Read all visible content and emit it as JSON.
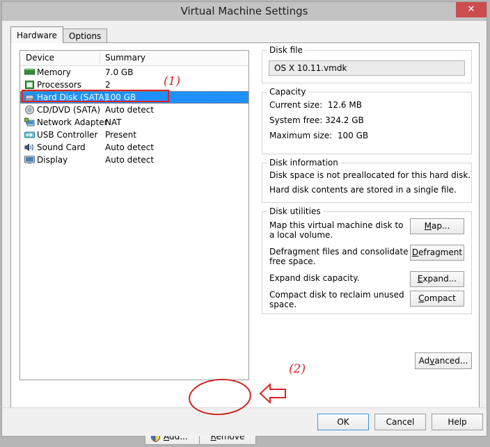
{
  "window": {
    "title": "Virtual Machine Settings",
    "close_label": "✕"
  },
  "tabs": [
    {
      "label": "Hardware",
      "active": true
    },
    {
      "label": "Options",
      "active": false
    }
  ],
  "device_list": {
    "columns": [
      "Device",
      "Summary"
    ],
    "rows": [
      {
        "icon": "memory-icon",
        "device": "Memory",
        "summary": "7.0 GB",
        "selected": false
      },
      {
        "icon": "processors-icon",
        "device": "Processors",
        "summary": "2",
        "selected": false
      },
      {
        "icon": "hard-disk-icon",
        "device": "Hard Disk (SATA)",
        "summary": "100 GB",
        "selected": true
      },
      {
        "icon": "cd-dvd-icon",
        "device": "CD/DVD (SATA)",
        "summary": "Auto detect",
        "selected": false
      },
      {
        "icon": "network-adapter-icon",
        "device": "Network Adapter",
        "summary": "NAT",
        "selected": false
      },
      {
        "icon": "usb-controller-icon",
        "device": "USB Controller",
        "summary": "Present",
        "selected": false
      },
      {
        "icon": "sound-card-icon",
        "device": "Sound Card",
        "summary": "Auto detect",
        "selected": false
      },
      {
        "icon": "display-icon",
        "device": "Display",
        "summary": "Auto detect",
        "selected": false
      }
    ]
  },
  "disk_file": {
    "group_title": "Disk file",
    "value": "OS X 10.11.vmdk"
  },
  "capacity": {
    "group_title": "Capacity",
    "current_size": "Current size:  12.6 MB",
    "system_free": "System free: 324.2 GB",
    "maximum_size": "Maximum size:  100 GB"
  },
  "disk_information": {
    "group_title": "Disk information",
    "line1": "Disk space is not preallocated for this hard disk.",
    "line2": "Hard disk contents are stored in a single file."
  },
  "disk_utilities": {
    "group_title": "Disk utilities",
    "rows": [
      {
        "text": "Map this virtual machine disk to a local volume.",
        "button": "Map..."
      },
      {
        "text": "Defragment files and consolidate free space.",
        "button": "Defragment"
      },
      {
        "text": "Expand disk capacity.",
        "button": "Expand..."
      },
      {
        "text": "Compact disk to reclaim unused space.",
        "button": "Compact"
      }
    ]
  },
  "advanced_button": "Advanced...",
  "list_buttons": {
    "add": "Add...",
    "remove": "Remove"
  },
  "footer_buttons": {
    "ok": "OK",
    "cancel": "Cancel",
    "help": "Help"
  },
  "annotations": {
    "label_1": "(1)",
    "label_2": "(2)",
    "color": "#e02020"
  },
  "colors": {
    "selection_blue": "#1e90ff",
    "close_red": "#cb4d4d",
    "titlebar_gray": "#c3c3c3",
    "dialog_face": "#f0f0f0"
  }
}
